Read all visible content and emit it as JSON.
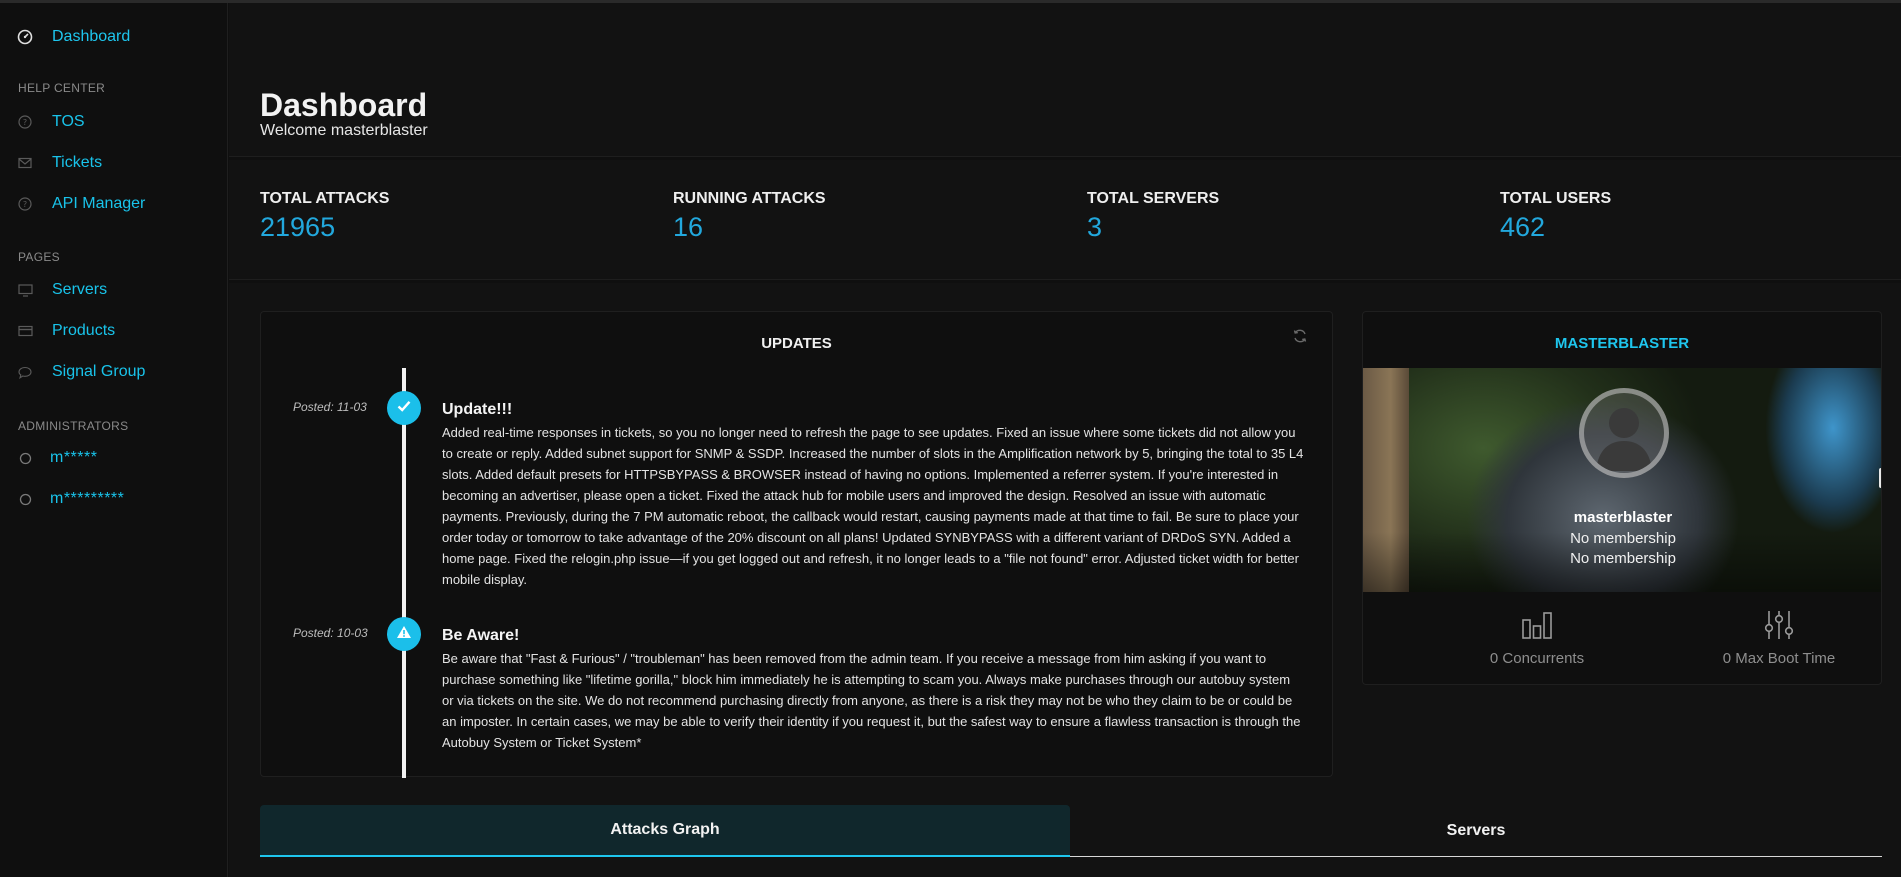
{
  "sidebar": {
    "dashboard": "Dashboard",
    "sections": {
      "help_center": "HELP CENTER",
      "pages": "PAGES",
      "administrators": "ADMINISTRATORS"
    },
    "help_items": [
      {
        "label": "TOS",
        "icon": "question-circle-icon"
      },
      {
        "label": "Tickets",
        "icon": "envelope-icon"
      },
      {
        "label": "API Manager",
        "icon": "question-circle-icon"
      }
    ],
    "page_items": [
      {
        "label": "Servers",
        "icon": "monitor-icon"
      },
      {
        "label": "Products",
        "icon": "credit-card-icon"
      },
      {
        "label": "Signal Group",
        "icon": "chat-bubble-icon"
      }
    ],
    "admins": [
      "m*****",
      "m*********"
    ]
  },
  "header": {
    "title": "Dashboard",
    "subtitle": "Welcome masterblaster"
  },
  "stats": [
    {
      "label": "TOTAL ATTACKS",
      "value": "21965"
    },
    {
      "label": "RUNNING ATTACKS",
      "value": "16"
    },
    {
      "label": "TOTAL SERVERS",
      "value": "3"
    },
    {
      "label": "TOTAL USERS",
      "value": "462"
    }
  ],
  "updates": {
    "title": "UPDATES",
    "entries": [
      {
        "date": "Posted: 11-03",
        "icon": "check-icon",
        "title": "Update!!!",
        "body": "Added real-time responses in tickets, so you no longer need to refresh the page to see updates. Fixed an issue where some tickets did not allow you to create or reply. Added subnet support for SNMP & SSDP. Increased the number of slots in the Amplification network by 5, bringing the total to 35 L4 slots. Added default presets for HTTPSBYPASS & BROWSER instead of having no options. Implemented a referrer system. If you're interested in becoming an advertiser, please open a ticket. Fixed the attack hub for mobile users and improved the design. Resolved an issue with automatic payments. Previously, during the 7 PM automatic reboot, the callback would restart, causing payments made at that time to fail. Be sure to place your order today or tomorrow to take advantage of the 20% discount on all plans! Updated SYNBYPASS with a different variant of DRDoS SYN. Added a home page. Fixed the relogin.php issue—if you get logged out and refresh, it no longer leads to a \"file not found\" error. Adjusted ticket width for better mobile display."
      },
      {
        "date": "Posted: 10-03",
        "icon": "warning-icon",
        "title": "Be Aware!",
        "body": "Be aware that \"Fast & Furious\" / \"troubleman\" has been removed from the admin team. If you receive a message from him asking if you want to purchase something like \"lifetime gorilla,\" block him immediately he is attempting to scam you. Always make purchases through our autobuy system or via tickets on the site. We do not recommend purchasing directly from anyone, as there is a risk they may not be who they claim to be or could be an imposter. In certain cases, we may be able to verify their identity if you request it, but the safest way to ensure a flawless transaction is through the Autobuy System or Ticket System*"
      }
    ]
  },
  "profile": {
    "heading": "MASTERBLASTER",
    "username": "masterblaster",
    "membership_1": "No membership",
    "membership_2": "No membership",
    "concurrents": "0 Concurrents",
    "max_boot_time": "0 Max Boot Time"
  },
  "tabs": [
    {
      "label": "Attacks Graph",
      "active": true
    },
    {
      "label": "Servers",
      "active": false
    }
  ],
  "colors": {
    "accent": "#1ec6ee",
    "stat_value": "#22a8dd",
    "background": "#0f0f0f",
    "panel": "#121212"
  }
}
